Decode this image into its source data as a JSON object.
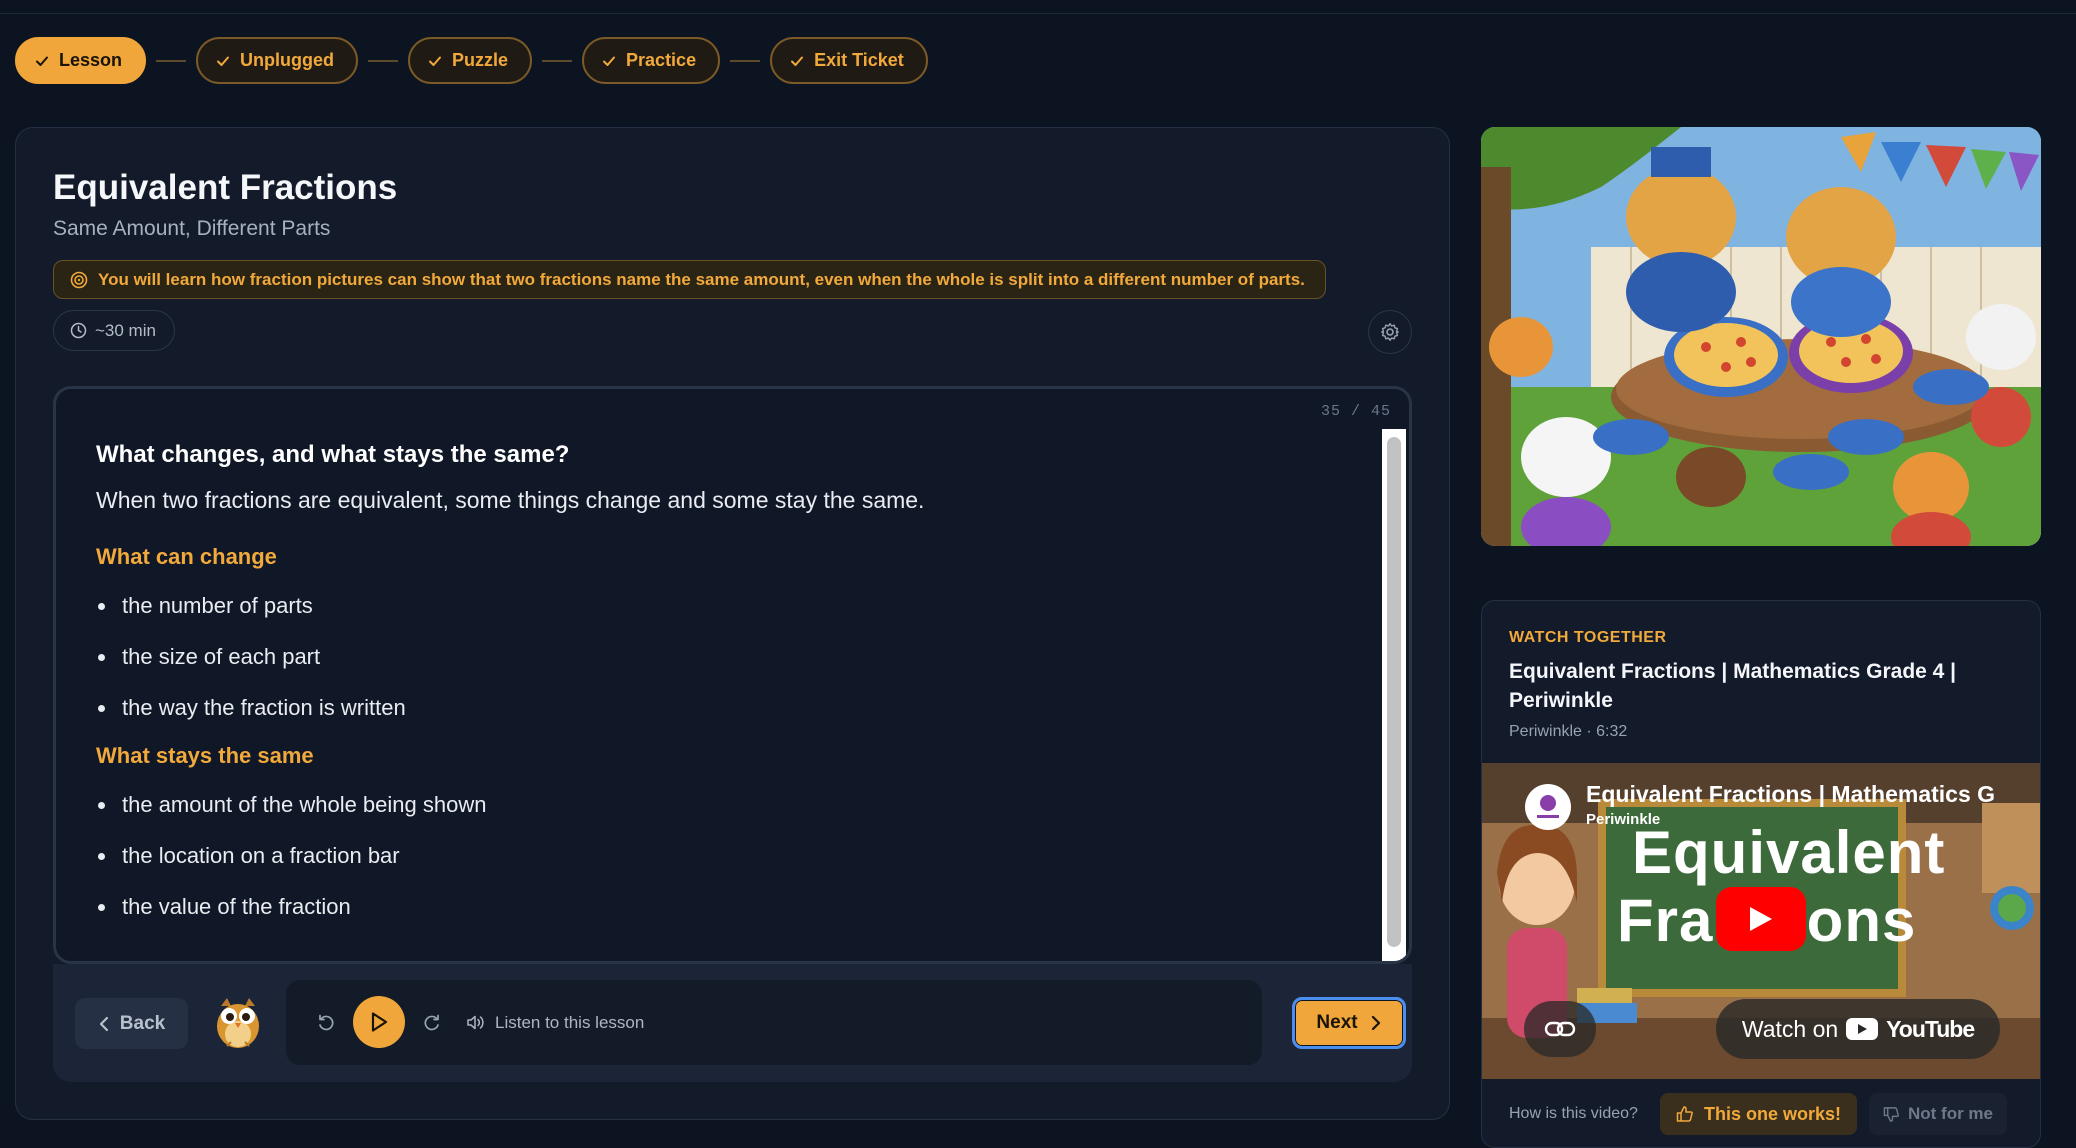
{
  "stepper": {
    "steps": [
      {
        "label": "Lesson"
      },
      {
        "label": "Unplugged"
      },
      {
        "label": "Puzzle"
      },
      {
        "label": "Practice"
      },
      {
        "label": "Exit Ticket"
      }
    ]
  },
  "lesson": {
    "title": "Equivalent Fractions",
    "subtitle": "Same Amount, Different Parts",
    "objective": "You will learn how fraction pictures can show that two fractions name the same amount, even when the whole is split into a different number of parts.",
    "duration": "~30 min"
  },
  "slide": {
    "counter": "35 / 45",
    "heading": "What changes, and what stays the same?",
    "intro": "When two fractions are equivalent, some things change and some stay the same.",
    "section1_title": "What can change",
    "section1_items": [
      "the number of parts",
      "the size of each part",
      "the way the fraction is written"
    ],
    "section2_title": "What stays the same",
    "section2_items": [
      "the amount of the whole being shown",
      "the location on a fraction bar",
      "the value of the fraction"
    ]
  },
  "controls": {
    "back_label": "Back",
    "listen_label": "Listen to this lesson",
    "next_label": "Next"
  },
  "video": {
    "eyebrow": "WATCH TOGETHER",
    "title": "Equivalent Fractions | Mathematics Grade 4 | Periwinkle",
    "meta": "Periwinkle · 6:32",
    "thumb_title": "Equivalent Fractions | Mathematics G",
    "thumb_channel": "Periwinkle",
    "thumb_line1": "Equivalent",
    "thumb_line2": "Fra",
    "thumb_line3": "ions",
    "watch_on": "Watch on",
    "youtube": "YouTube",
    "feedback_question": "How is this video?",
    "works_label": "This one works!",
    "notfor_label": "Not for me"
  },
  "colors": {
    "accent": "#f0a63a",
    "background": "#0d1421",
    "card": "#131b2a"
  }
}
